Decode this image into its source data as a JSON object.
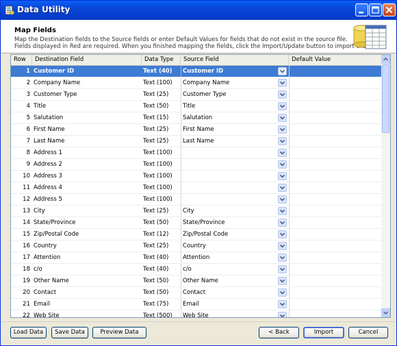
{
  "window": {
    "title": "Data Utility",
    "app_icon": "data-utility-icon"
  },
  "title_buttons": [
    "minimize",
    "maximize",
    "close"
  ],
  "header": {
    "title": "Map Fields",
    "line1": "Map the Destination fields to the Source fields or enter Default Values for fields that do not exist in the source file.",
    "line2": "Fields displayed in Red are required.  When you finished mapping the fields, click the Import/Update button to import the data.",
    "icon": "database-spreadsheet-icon"
  },
  "grid": {
    "columns": {
      "row": "Row",
      "dest": "Destination Field",
      "type": "Data Type",
      "src": "Source Field",
      "def": "Default Value"
    },
    "rows": [
      {
        "n": "1",
        "dest": "Customer ID",
        "type": "Text (40)",
        "src": "Customer ID",
        "selected": true
      },
      {
        "n": "2",
        "dest": "Company Name",
        "type": "Text (100)",
        "src": "Company Name"
      },
      {
        "n": "3",
        "dest": "Customer Type",
        "type": "Text (25)",
        "src": "Customer Type"
      },
      {
        "n": "4",
        "dest": "Title",
        "type": "Text (50)",
        "src": "Title"
      },
      {
        "n": "5",
        "dest": "Salutation",
        "type": "Text (15)",
        "src": "Salutation"
      },
      {
        "n": "6",
        "dest": "First Name",
        "type": "Text (25)",
        "src": "First Name"
      },
      {
        "n": "7",
        "dest": "Last Name",
        "type": "Text (25)",
        "src": "Last Name"
      },
      {
        "n": "8",
        "dest": "Address 1",
        "type": "Text (100)",
        "src": ""
      },
      {
        "n": "9",
        "dest": "Address 2",
        "type": "Text (100)",
        "src": ""
      },
      {
        "n": "10",
        "dest": "Address 3",
        "type": "Text (100)",
        "src": ""
      },
      {
        "n": "11",
        "dest": "Address 4",
        "type": "Text (100)",
        "src": ""
      },
      {
        "n": "12",
        "dest": "Address 5",
        "type": "Text (100)",
        "src": ""
      },
      {
        "n": "13",
        "dest": "City",
        "type": "Text (25)",
        "src": "City"
      },
      {
        "n": "14",
        "dest": "State/Province",
        "type": "Text (50)",
        "src": "State/Province"
      },
      {
        "n": "15",
        "dest": "Zip/Postal Code",
        "type": "Text (12)",
        "src": "Zip/Postal Code"
      },
      {
        "n": "16",
        "dest": "Country",
        "type": "Text (25)",
        "src": "Country"
      },
      {
        "n": "17",
        "dest": "Attention",
        "type": "Text (40)",
        "src": "Attention"
      },
      {
        "n": "18",
        "dest": "c/o",
        "type": "Text (40)",
        "src": "c/o"
      },
      {
        "n": "19",
        "dest": "Other Name",
        "type": "Text (50)",
        "src": "Other Name"
      },
      {
        "n": "20",
        "dest": "Contact",
        "type": "Text (50)",
        "src": "Contact"
      },
      {
        "n": "21",
        "dest": "Email",
        "type": "Text (75)",
        "src": "Email"
      },
      {
        "n": "22",
        "dest": "Web Site",
        "type": "Text (500)",
        "src": "Web Site"
      }
    ]
  },
  "buttons": {
    "load": "Load Data",
    "save": "Save Data",
    "preview": "Preview Data",
    "back": "< Back",
    "import": "Import",
    "cancel": "Cancel"
  },
  "colors": {
    "titlebar": "#0a5ef5",
    "selection": "#3e7bd4",
    "window": "#ece9d8"
  }
}
